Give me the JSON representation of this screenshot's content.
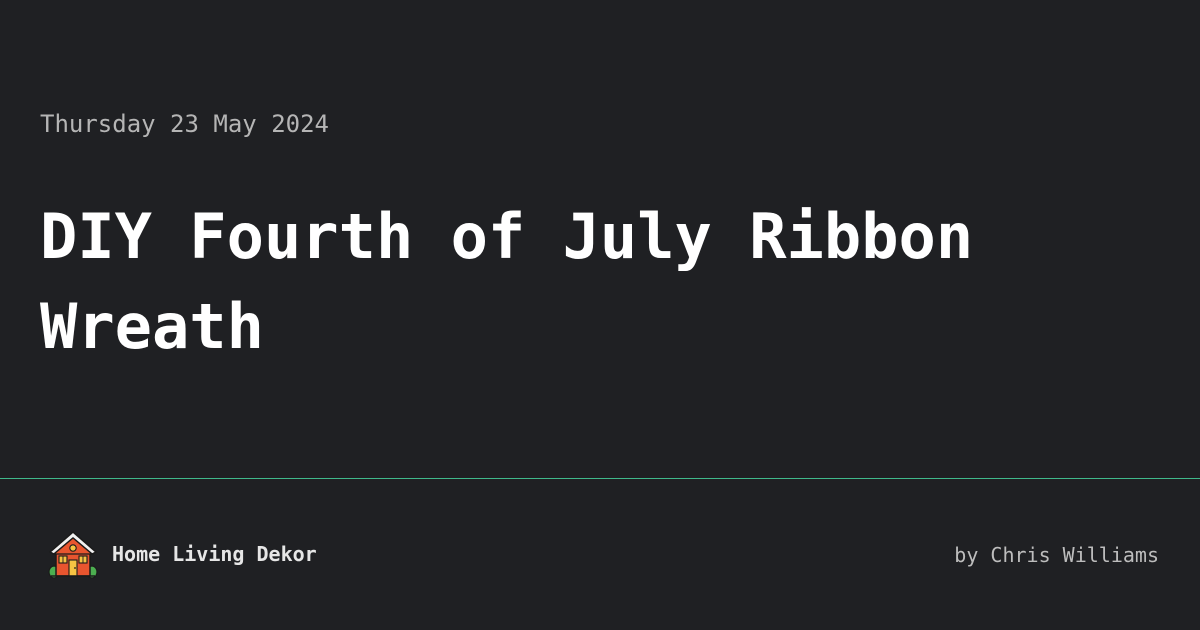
{
  "post": {
    "date": "Thursday 23 May 2024",
    "title": "DIY Fourth of July Ribbon Wreath"
  },
  "footer": {
    "site_name": "Home Living Dekor",
    "author": "by Chris Williams",
    "logo_icon": "house-icon"
  },
  "colors": {
    "background": "#1f2023",
    "divider": "#3fb98b",
    "title": "#ffffff",
    "muted_text": "#b5b5b5",
    "house_wall": "#e8552f",
    "house_roof": "#f2f2f2"
  }
}
